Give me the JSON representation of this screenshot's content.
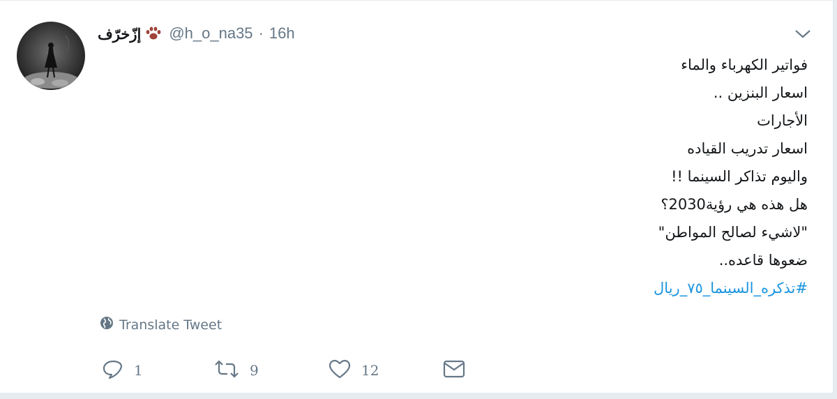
{
  "tweet": {
    "display_name": "إزّخرّف",
    "handle": "@h_o_na35",
    "separator": "·",
    "time": "16h",
    "lines": [
      "فواتير الكهرباء والماء",
      "اسعار البنزين ..",
      "الأجارات",
      " اسعار تدريب القياده",
      "واليوم تذاكر السينما !!",
      "هل هذه هي رؤية2030؟",
      "\"لاشيء لصالح المواطن\"",
      "ضعوها قاعده.."
    ],
    "hashtag": "#تذكره_السينما_٧٥_ريال",
    "translate_label": "Translate Tweet"
  },
  "actions": {
    "reply_count": "1",
    "retweet_count": "9",
    "like_count": "12"
  },
  "icons": {
    "caret": "chevron-down-icon",
    "paw": "paw-icon",
    "globe": "globe-icon",
    "reply": "reply-icon",
    "retweet": "retweet-icon",
    "like": "heart-icon",
    "message": "envelope-icon"
  },
  "colors": {
    "link": "#1b95e0",
    "secondary": "#657786",
    "text": "#14171a",
    "paw": "#a0433a"
  }
}
